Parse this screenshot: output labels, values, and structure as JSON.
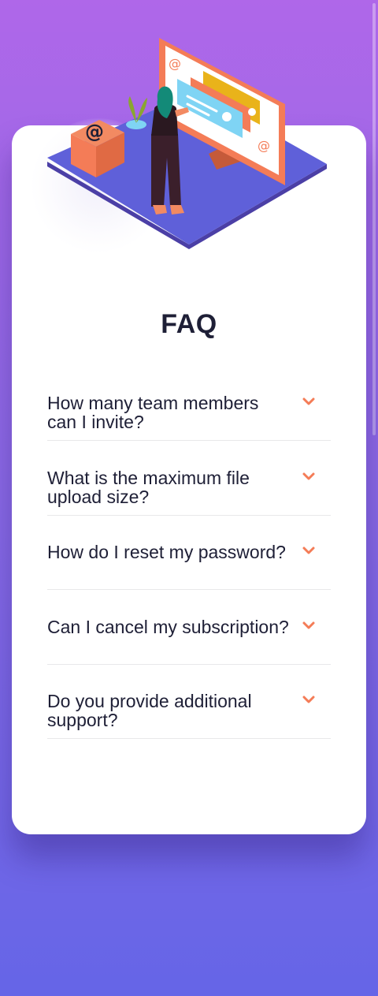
{
  "faq": {
    "title": "FAQ",
    "items": [
      {
        "question": "How many team members can I invite?",
        "expanded": false
      },
      {
        "question": "What is the maximum file upload size?",
        "expanded": false
      },
      {
        "question": "How do I reset my password?",
        "expanded": false
      },
      {
        "question": "Can I cancel my subscription?",
        "expanded": false
      },
      {
        "question": "Do you provide additional support?",
        "expanded": false
      }
    ]
  },
  "illustration": {
    "name": "woman-at-computer-illustration",
    "icons": [
      "at-sign-icon",
      "plant-icon"
    ]
  },
  "colors": {
    "background_top": "#af67e9",
    "background_bottom": "#6565e7",
    "card": "#ffffff",
    "text": "#1e1f36",
    "accent_chevron": "#f47c57",
    "divider": "#e8e8ea",
    "platform": "#5f60d9"
  }
}
